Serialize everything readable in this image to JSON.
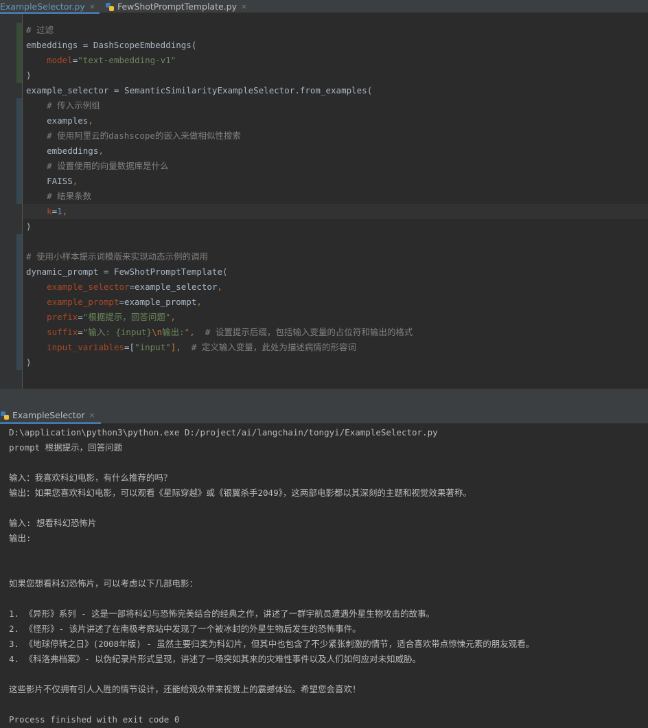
{
  "tabs": [
    {
      "label": "ExampleSelector.py",
      "active": true
    },
    {
      "label": "FewShotPromptTemplate.py",
      "active": false
    }
  ],
  "close_glyph": "×",
  "editor": {
    "lines": [
      [
        {
          "t": "# 过滤",
          "c": "c"
        }
      ],
      [
        {
          "t": "embeddings = DashScopeEmbeddings(",
          "c": ""
        }
      ],
      [
        {
          "t": "    ",
          "c": ""
        },
        {
          "t": "model",
          "c": "pm"
        },
        {
          "t": "=",
          "c": ""
        },
        {
          "t": "\"text-embedding-v1\"",
          "c": "s"
        }
      ],
      [
        {
          "t": ")",
          "c": ""
        }
      ],
      [
        {
          "t": "example_selector = SemanticSimilarityExampleSelector.from_examples(",
          "c": ""
        }
      ],
      [
        {
          "t": "    ",
          "c": ""
        },
        {
          "t": "# 传入示例组",
          "c": "c"
        }
      ],
      [
        {
          "t": "    examples",
          "c": ""
        },
        {
          "t": ",",
          "c": "kw"
        }
      ],
      [
        {
          "t": "    ",
          "c": ""
        },
        {
          "t": "# 使用阿里云的dashscope的嵌入来做相似性搜索",
          "c": "c"
        }
      ],
      [
        {
          "t": "    embeddings",
          "c": ""
        },
        {
          "t": ",",
          "c": "kw"
        }
      ],
      [
        {
          "t": "    ",
          "c": ""
        },
        {
          "t": "# 设置使用的向量数据库是什么",
          "c": "c"
        }
      ],
      [
        {
          "t": "    FAISS",
          "c": ""
        },
        {
          "t": ",",
          "c": "kw"
        }
      ],
      [
        {
          "t": "    ",
          "c": ""
        },
        {
          "t": "# 结果条数",
          "c": "c"
        }
      ],
      [
        {
          "t": "    ",
          "c": ""
        },
        {
          "t": "k",
          "c": "pm"
        },
        {
          "t": "=",
          "c": ""
        },
        {
          "t": "1",
          "c": "n"
        },
        {
          "t": ",",
          "c": "kw"
        }
      ],
      [
        {
          "t": ")",
          "c": ""
        }
      ],
      [],
      [
        {
          "t": "# 使用小样本提示词模版来实现动态示例的调用",
          "c": "c"
        }
      ],
      [
        {
          "t": "dynamic_prompt = FewShotPromptTemplate(",
          "c": ""
        }
      ],
      [
        {
          "t": "    ",
          "c": ""
        },
        {
          "t": "example_selector",
          "c": "pm"
        },
        {
          "t": "=example_selector",
          "c": ""
        },
        {
          "t": ",",
          "c": "kw"
        }
      ],
      [
        {
          "t": "    ",
          "c": ""
        },
        {
          "t": "example_prompt",
          "c": "pm"
        },
        {
          "t": "=example_prompt",
          "c": ""
        },
        {
          "t": ",",
          "c": "kw"
        }
      ],
      [
        {
          "t": "    ",
          "c": ""
        },
        {
          "t": "prefix",
          "c": "pm"
        },
        {
          "t": "=",
          "c": ""
        },
        {
          "t": "\"根据提示，回答问题\"",
          "c": "s"
        },
        {
          "t": ",",
          "c": "kw"
        }
      ],
      [
        {
          "t": "    ",
          "c": ""
        },
        {
          "t": "suffix",
          "c": "pm"
        },
        {
          "t": "=",
          "c": ""
        },
        {
          "t": "\"输入: {input}",
          "c": "s"
        },
        {
          "t": "\\n",
          "c": "esc"
        },
        {
          "t": "输出:\"",
          "c": "s"
        },
        {
          "t": ",",
          "c": "kw"
        },
        {
          "t": "  ",
          "c": ""
        },
        {
          "t": "# 设置提示后缀，包括输入变量的占位符和输出的格式",
          "c": "c"
        }
      ],
      [
        {
          "t": "    ",
          "c": ""
        },
        {
          "t": "input_variables",
          "c": "pm"
        },
        {
          "t": "=[",
          "c": ""
        },
        {
          "t": "\"input\"",
          "c": "s"
        },
        {
          "t": "],",
          "c": "kw"
        },
        {
          "t": "  ",
          "c": ""
        },
        {
          "t": "# 定义输入变量，此处为描述病情的形容词",
          "c": "c"
        }
      ],
      [
        {
          "t": ")",
          "c": ""
        }
      ]
    ],
    "current_line": 12
  },
  "run_panel": {
    "tab_label": "ExampleSelector",
    "output": [
      "D:\\application\\python3\\python.exe D:/project/ai/langchain/tongyi/ExampleSelector.py",
      "prompt 根据提示，回答问题",
      "",
      "输入：我喜欢科幻电影，有什么推荐的吗？",
      "输出：如果您喜欢科幻电影，可以观看《星际穿越》或《银翼杀手2049》，这两部电影都以其深刻的主题和视觉效果著称。",
      "",
      "输入: 想看科幻恐怖片",
      "输出:",
      "",
      "",
      "如果您想看科幻恐怖片，可以考虑以下几部电影：",
      "",
      "1. 《异形》系列 - 这是一部将科幻与恐怖完美结合的经典之作，讲述了一群宇航员遭遇外星生物攻击的故事。",
      "2. 《怪形》- 该片讲述了在南极考察站中发现了一个被冰封的外星生物后发生的恐怖事件。",
      "3. 《地球停转之日》(2008年版) - 虽然主要归类为科幻片，但其中也包含了不少紧张刺激的情节，适合喜欢带点惊悚元素的朋友观看。",
      "4. 《科洛弗档案》- 以伪纪录片形式呈现，讲述了一场突如其来的灾难性事件以及人们如何应对未知威胁。",
      "",
      "这些影片不仅拥有引人入胜的情节设计，还能给观众带来视觉上的震撼体验。希望您会喜欢！",
      "",
      "Process finished with exit code 0"
    ]
  }
}
